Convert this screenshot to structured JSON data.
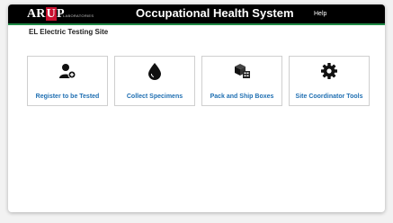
{
  "header": {
    "logo_text": "ARUP",
    "logo_subtext": "LABORATORIES",
    "title": "Occupational Health System",
    "help_label": "Help"
  },
  "site": {
    "name": "EL Electric Testing Site"
  },
  "tiles": [
    {
      "label": "Register to be Tested",
      "icon": "add-user-icon"
    },
    {
      "label": "Collect Specimens",
      "icon": "drop-icon"
    },
    {
      "label": "Pack and Ship Boxes",
      "icon": "boxes-icon"
    },
    {
      "label": "Site Coordinator Tools",
      "icon": "gear-icon"
    }
  ],
  "colors": {
    "header_bg": "#000000",
    "header_accent": "#1f8a46",
    "logo_red": "#c8102e",
    "tile_label": "#1f6fb2"
  }
}
